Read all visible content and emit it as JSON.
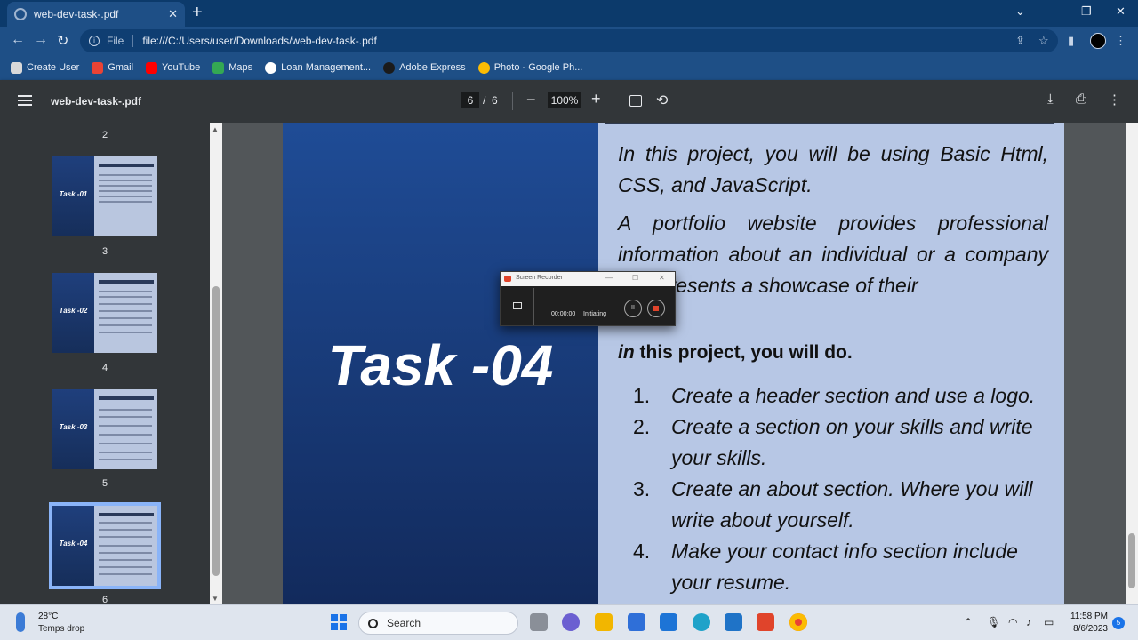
{
  "browser": {
    "tab_title": "web-dev-task-.pdf",
    "address_scheme": "File",
    "address_url": "file:///C:/Users/user/Downloads/web-dev-task-.pdf",
    "bookmarks": [
      {
        "label": "Create User",
        "icon": "folder-icon",
        "color": "#d9d9d9"
      },
      {
        "label": "Gmail",
        "icon": "gmail-icon",
        "color": "#ea4335"
      },
      {
        "label": "YouTube",
        "icon": "youtube-icon",
        "color": "#ff0000"
      },
      {
        "label": "Maps",
        "icon": "maps-icon",
        "color": "#34a853"
      },
      {
        "label": "Loan Management...",
        "icon": "globe-icon",
        "color": "#ffffff"
      },
      {
        "label": "Adobe Express",
        "icon": "adobe-icon",
        "color": "#1b1b1b"
      },
      {
        "label": "Photo - Google Ph...",
        "icon": "photos-icon",
        "color": "#fbbc04"
      }
    ]
  },
  "pdf_toolbar": {
    "title": "web-dev-task-.pdf",
    "current_page": "6",
    "separator": "/",
    "total_pages": "6",
    "zoom": "100%"
  },
  "thumbnails": {
    "numbers": [
      "2",
      "3",
      "4",
      "5",
      "6"
    ],
    "labels": [
      "Task -01",
      "Task -02",
      "Task -03",
      "Task -04"
    ]
  },
  "page": {
    "big_title": "Task -04",
    "paragraph1": "In this project, you will be using Basic Html, CSS, and JavaScript.",
    "paragraph2": "A portfolio website provides professional information about an individual or a company and presents a showcase of their",
    "heading_em": "in",
    "heading_rest": " this project, you will do.",
    "list": [
      {
        "num": "1.",
        "text": "Create a header section and use a logo."
      },
      {
        "num": "2.",
        "text": "Create a section on your skills and write your skills."
      },
      {
        "num": "3.",
        "text": "Create an about section. Where you will write about yourself."
      },
      {
        "num": "4.",
        "text": "Make your contact info section include your resume."
      }
    ]
  },
  "recorder": {
    "title": "Screen Recorder",
    "time": "00:00:00",
    "status": "Initiating"
  },
  "taskbar": {
    "temperature": "28°C",
    "condition": "Temps drop",
    "search_placeholder": "Search",
    "time": "11:58 PM",
    "date": "8/6/2023",
    "notification_count": "5"
  }
}
